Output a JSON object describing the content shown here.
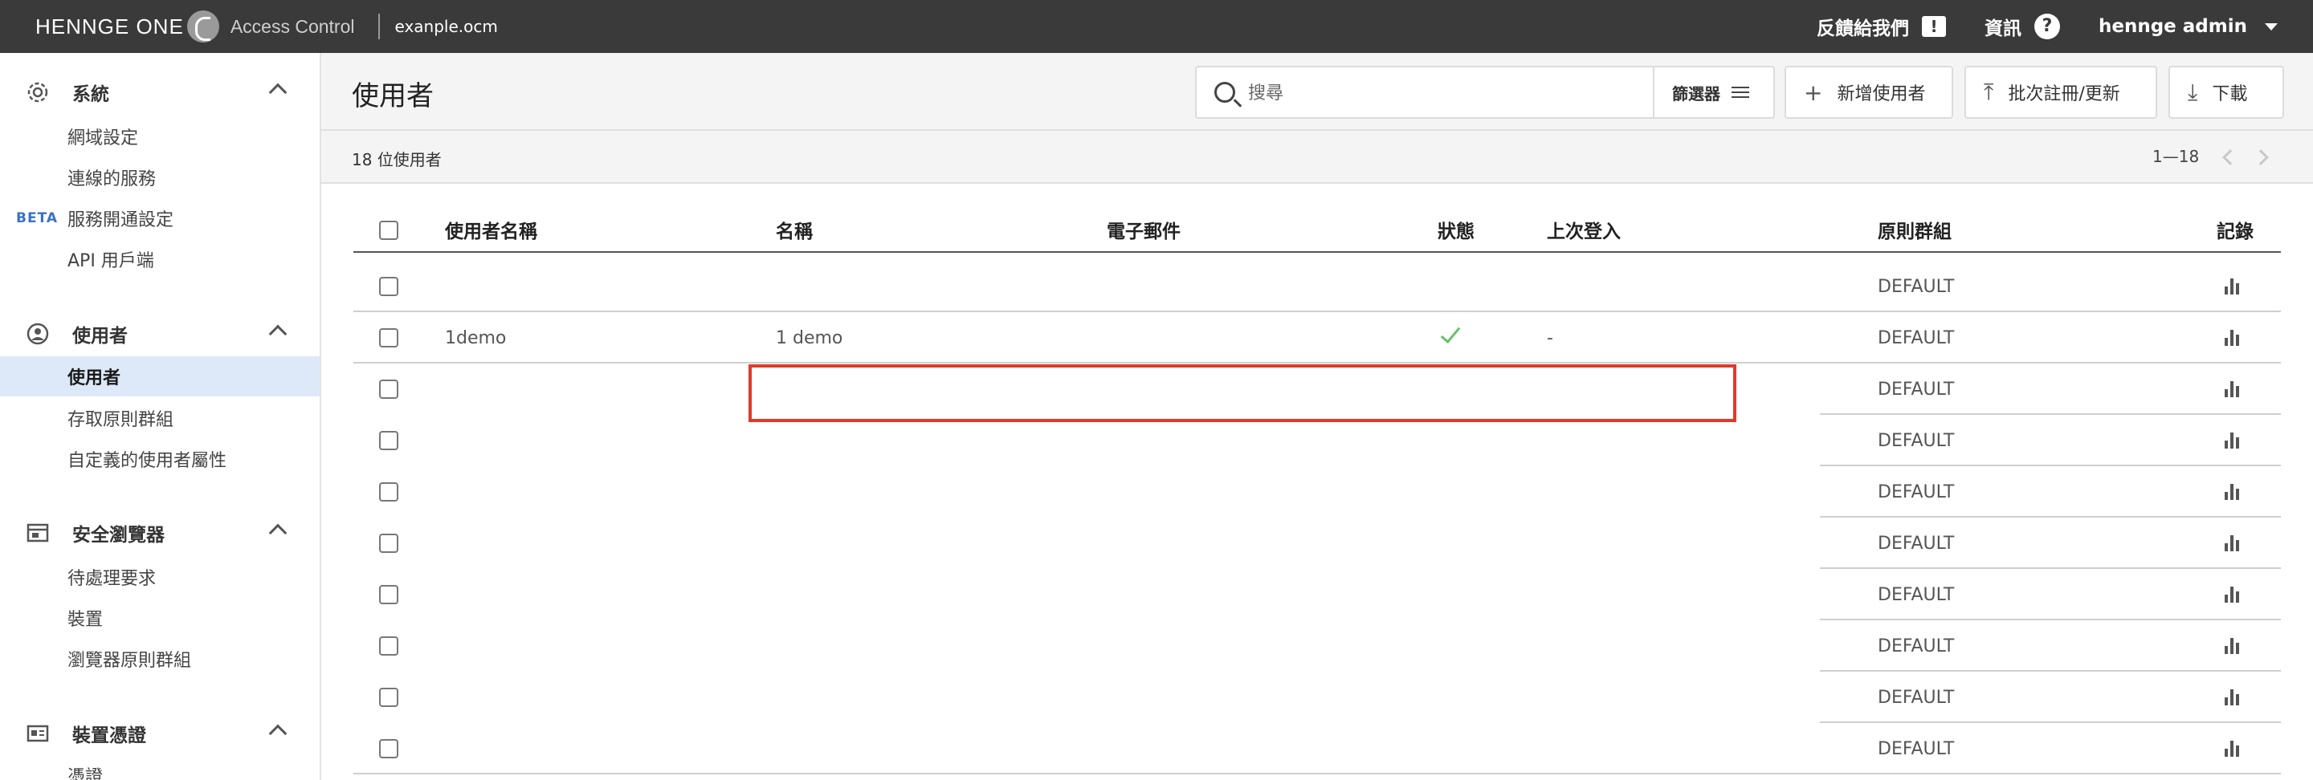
{
  "topbar": {
    "brand": "HENNGE ONE",
    "product": "Access Control",
    "tenant": "exanple.ocm",
    "feedback": "反饋給我們",
    "info": "資訊",
    "user": "hennge admin"
  },
  "sidebar": {
    "sections": [
      {
        "label": "系統",
        "icon": "gear-icon",
        "items": [
          {
            "label": "網域設定"
          },
          {
            "label": "連線的服務"
          },
          {
            "label": "服務開通設定",
            "badge": "BETA"
          },
          {
            "label": "API 用戶端"
          }
        ]
      },
      {
        "label": "使用者",
        "icon": "user-circle-icon",
        "items": [
          {
            "label": "使用者",
            "active": true
          },
          {
            "label": "存取原則群組"
          },
          {
            "label": "自定義的使用者屬性"
          }
        ]
      },
      {
        "label": "安全瀏覽器",
        "icon": "browser-window-icon",
        "items": [
          {
            "label": "待處理要求"
          },
          {
            "label": "裝置"
          },
          {
            "label": "瀏覽器原則群組"
          }
        ]
      },
      {
        "label": "裝置憑證",
        "icon": "id-card-icon",
        "items": [
          {
            "label": "憑證"
          }
        ]
      }
    ]
  },
  "main": {
    "title": "使用者",
    "search_placeholder": "搜尋",
    "filter_label": "篩選器",
    "add_user": "新增使用者",
    "bulk": "批次註冊/更新",
    "download": "下載",
    "count": "18 位使用者",
    "range": "1—18"
  },
  "table": {
    "columns": [
      "使用者名稱",
      "名稱",
      "電子郵件",
      "狀態",
      "上次登入",
      "原則群組",
      "記錄"
    ],
    "rows": [
      {
        "username": "",
        "name": "",
        "email": "",
        "status": "",
        "last_login": "",
        "group": "DEFAULT"
      },
      {
        "username": "1demo",
        "name": "1 demo",
        "email": "",
        "status": "active",
        "last_login": "-",
        "group": "DEFAULT"
      },
      {
        "username": "",
        "name": "",
        "email": "",
        "status": "",
        "last_login": "",
        "group": "DEFAULT"
      },
      {
        "username": "",
        "name": "",
        "email": "",
        "status": "",
        "last_login": "",
        "group": "DEFAULT"
      },
      {
        "username": "",
        "name": "",
        "email": "",
        "status": "",
        "last_login": "",
        "group": "DEFAULT"
      },
      {
        "username": "",
        "name": "",
        "email": "",
        "status": "",
        "last_login": "",
        "group": "DEFAULT"
      },
      {
        "username": "",
        "name": "",
        "email": "",
        "status": "",
        "last_login": "",
        "group": "DEFAULT"
      },
      {
        "username": "",
        "name": "",
        "email": "",
        "status": "",
        "last_login": "",
        "group": "DEFAULT"
      },
      {
        "username": "",
        "name": "",
        "email": "",
        "status": "",
        "last_login": "",
        "group": "DEFAULT"
      },
      {
        "username": "",
        "name": "",
        "email": "",
        "status": "",
        "last_login": "",
        "group": "DEFAULT"
      }
    ]
  },
  "colors": {
    "topbar": "#3a3a3a",
    "active_nav": "#dde9f8",
    "beta": "#3a72c4",
    "highlight": "#e03a2a",
    "status_ok": "#6bbf6b"
  }
}
